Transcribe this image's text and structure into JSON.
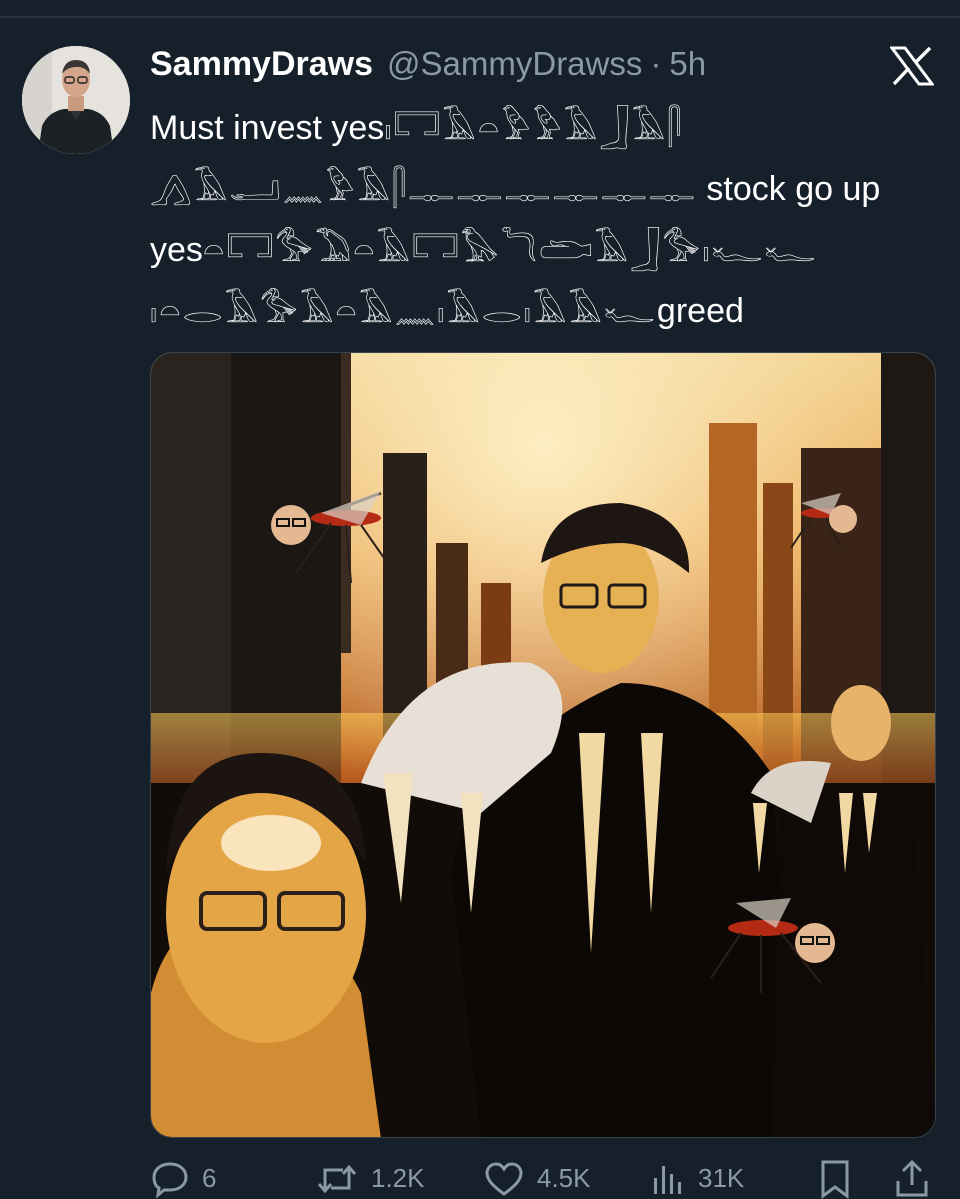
{
  "tweet": {
    "display_name": "SammyDraws",
    "handle": "@SammyDrawss",
    "separator": "·",
    "time": "5h",
    "body": {
      "line1_text": "Must invest yes",
      "line1_glyphs": "𓏤𓉐𓄿𓏏𓅱𓅱𓄿𓃀𓄿𓋴",
      "line2_glyphs": "𓂻𓄿𓂝𓈖𓅱𓄿𓋴𓊃𓊃𓊃𓊃𓊃𓊃",
      "line2_text": " stock go up",
      "line3_text": "yes",
      "line3_glyphs": "𓏏𓉐𓅜𓅐𓏏𓄿𓉐𓅃𓆓𓂧𓄿𓃀𓅜𓏤𓆑𓆑",
      "line4_glyphs": "𓏤𓏏𓂋𓄿𓅜𓄿𓏏𓄿𓈖𓏤𓄿𓂋𓏤𓄿𓄿𓆑",
      "line4_text": "greed"
    },
    "media": {
      "icons": [
        "scene-city",
        "portrait",
        "mosquito"
      ]
    },
    "actions": {
      "reply_count": "6",
      "retweet_count": "1.2K",
      "like_count": "4.5K",
      "view_count": "31K"
    },
    "icons": [
      "x-logo-icon",
      "reply-icon",
      "retweet-icon",
      "like-icon",
      "views-icon",
      "bookmark-icon",
      "share-icon"
    ],
    "colors": {
      "background": "#15202b",
      "secondary_text": "#8b98a5",
      "primary_text": "#ffffff"
    }
  }
}
